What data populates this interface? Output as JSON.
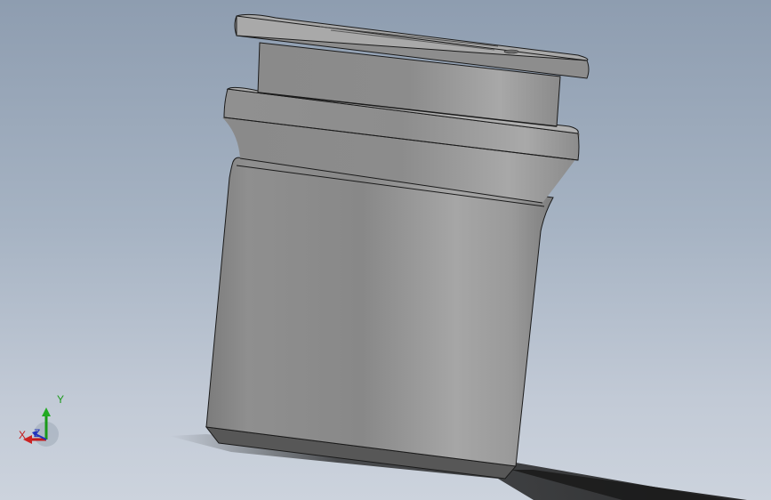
{
  "viewport": {
    "background_top": "#8e9db0",
    "background_bottom": "#ccd3dd"
  },
  "model": {
    "part": "cylindrical-bushing-with-flange",
    "body_color": "#8f8f8f",
    "highlight_color": "#b4b4b4",
    "shadow_color": "#5e5e5e",
    "edge_color": "#1a1a1a"
  },
  "triad": {
    "x_label": "X",
    "y_label": "Y",
    "z_label": "Z",
    "x_color": "#c41a1a",
    "y_color": "#1a9a1a",
    "z_color": "#2233bb"
  }
}
